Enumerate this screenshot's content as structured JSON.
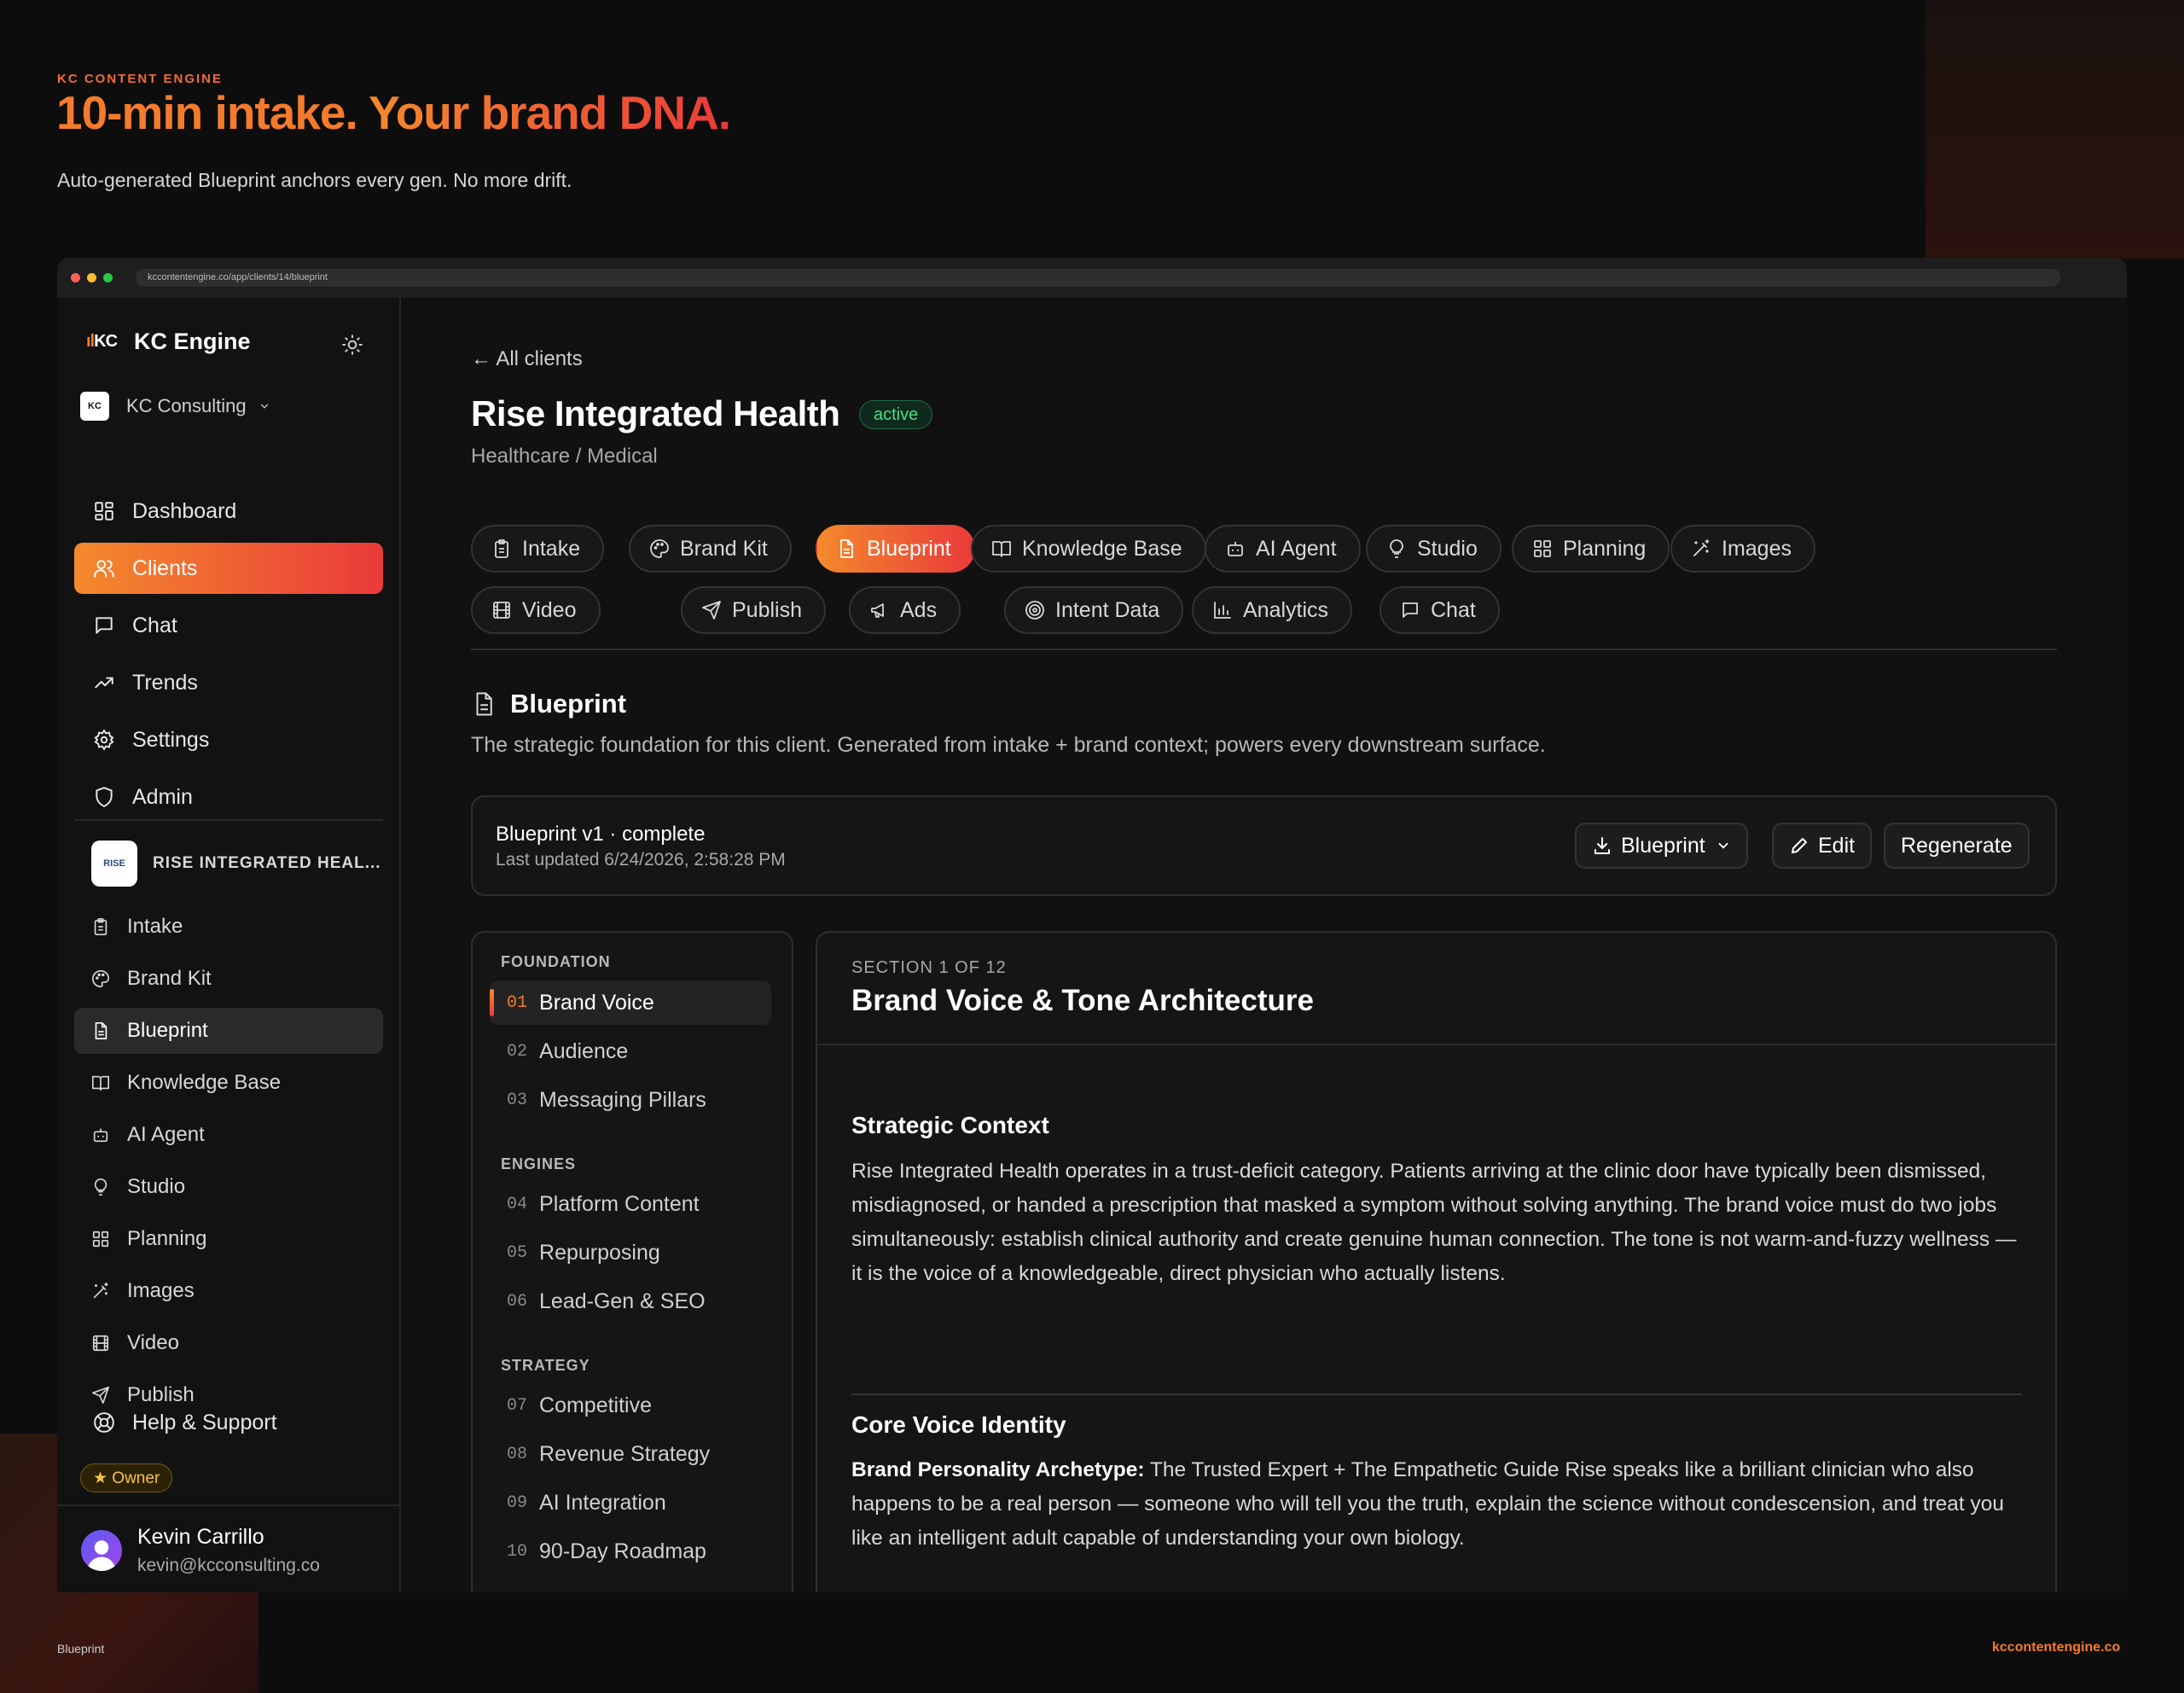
{
  "hero": {
    "eyebrow": "KC CONTENT ENGINE",
    "title_a": "10-min intake. ",
    "title_b": "Your brand DNA.",
    "subtitle": "Auto-generated Blueprint anchors every gen. No more drift."
  },
  "browser": {
    "url": "kccontentengine.co/app/clients/14/blueprint"
  },
  "sidebar": {
    "app_name": "KC Engine",
    "logo_text": "KC",
    "org_logo_text": "KC",
    "org_name": "KC Consulting",
    "nav": [
      {
        "label": "Dashboard",
        "icon": "dashboard-icon"
      },
      {
        "label": "Clients",
        "icon": "users-icon",
        "active": true
      },
      {
        "label": "Chat",
        "icon": "chat-icon"
      },
      {
        "label": "Trends",
        "icon": "trending-icon"
      },
      {
        "label": "Settings",
        "icon": "gear-icon"
      },
      {
        "label": "Admin",
        "icon": "shield-icon"
      }
    ],
    "client_name": "RISE INTEGRATED HEAL...",
    "client_logo_text": "RISE",
    "client_nav": [
      {
        "label": "Intake",
        "icon": "clipboard-icon"
      },
      {
        "label": "Brand Kit",
        "icon": "palette-icon"
      },
      {
        "label": "Blueprint",
        "icon": "document-icon",
        "active": true
      },
      {
        "label": "Knowledge Base",
        "icon": "book-icon"
      },
      {
        "label": "AI Agent",
        "icon": "bot-icon"
      },
      {
        "label": "Studio",
        "icon": "lightbulb-icon"
      },
      {
        "label": "Planning",
        "icon": "grid-icon"
      },
      {
        "label": "Images",
        "icon": "wand-icon"
      },
      {
        "label": "Video",
        "icon": "film-icon"
      },
      {
        "label": "Publish",
        "icon": "send-icon"
      }
    ],
    "help": "Help & Support",
    "owner_badge": "★ Owner",
    "user": {
      "name": "Kevin Carrillo",
      "email": "kevin@kcconsulting.co"
    }
  },
  "main": {
    "back_link": "← All clients",
    "client_title": "Rise Integrated Health",
    "status_badge": "active",
    "industry": "Healthcare / Medical",
    "tabs": [
      {
        "label": "Intake",
        "icon": "clipboard-icon"
      },
      {
        "label": "Brand Kit",
        "icon": "palette-icon"
      },
      {
        "label": "Blueprint",
        "icon": "document-icon",
        "active": true
      },
      {
        "label": "Knowledge Base",
        "icon": "book-icon"
      },
      {
        "label": "AI Agent",
        "icon": "bot-icon"
      },
      {
        "label": "Studio",
        "icon": "lightbulb-icon"
      },
      {
        "label": "Planning",
        "icon": "grid-icon"
      },
      {
        "label": "Images",
        "icon": "wand-icon"
      },
      {
        "label": "Video",
        "icon": "film-icon"
      },
      {
        "label": "Publish",
        "icon": "send-icon"
      },
      {
        "label": "Ads",
        "icon": "megaphone-icon"
      },
      {
        "label": "Intent Data",
        "icon": "target-icon"
      },
      {
        "label": "Analytics",
        "icon": "bar-chart-icon"
      },
      {
        "label": "Chat",
        "icon": "chat-icon"
      }
    ],
    "section_title": "Blueprint",
    "section_desc": "The strategic foundation for this client. Generated from intake + brand context; powers every downstream surface.",
    "status_card": {
      "title": "Blueprint v1 · complete",
      "updated": "Last updated 6/24/2026, 2:58:28 PM",
      "download_label": "Blueprint",
      "edit_label": "Edit",
      "regenerate_label": "Regenerate"
    },
    "toc": {
      "groups": [
        {
          "label": "FOUNDATION",
          "items": [
            {
              "num": "01",
              "label": "Brand Voice",
              "active": true
            },
            {
              "num": "02",
              "label": "Audience"
            },
            {
              "num": "03",
              "label": "Messaging Pillars"
            }
          ]
        },
        {
          "label": "ENGINES",
          "items": [
            {
              "num": "04",
              "label": "Platform Content"
            },
            {
              "num": "05",
              "label": "Repurposing"
            },
            {
              "num": "06",
              "label": "Lead-Gen & SEO"
            }
          ]
        },
        {
          "label": "STRATEGY",
          "items": [
            {
              "num": "07",
              "label": "Competitive"
            },
            {
              "num": "08",
              "label": "Revenue Strategy"
            },
            {
              "num": "09",
              "label": "AI Integration"
            },
            {
              "num": "10",
              "label": "90-Day Roadmap"
            }
          ]
        }
      ]
    },
    "content": {
      "eyebrow": "SECTION 1 OF 12",
      "title": "Brand Voice & Tone Architecture",
      "h1": "Strategic Context",
      "p1": "Rise Integrated Health operates in a trust-deficit category. Patients arriving at the clinic door have typically been dismissed, misdiagnosed, or handed a prescription that masked a symptom without solving anything. The brand voice must do two jobs simultaneously: establish clinical authority and create genuine human connection. The tone is not warm-and-fuzzy wellness — it is the voice of a knowledgeable, direct physician who actually listens.",
      "h2": "Core Voice Identity",
      "p2_label": "Brand Personality Archetype:",
      "p2": " The Trusted Expert + The Empathetic Guide Rise speaks like a brilliant clinician who also happens to be a real person — someone who will tell you the truth, explain the science without condescension, and treat you like an intelligent adult capable of understanding your own biology."
    }
  },
  "footer": {
    "left": "Blueprint",
    "right": "kccontentengine.co"
  },
  "colors": {
    "accent_start": "#f48a2c",
    "accent_end": "#ea3a3a",
    "success": "#4ade80",
    "owner": "#f5c542"
  }
}
